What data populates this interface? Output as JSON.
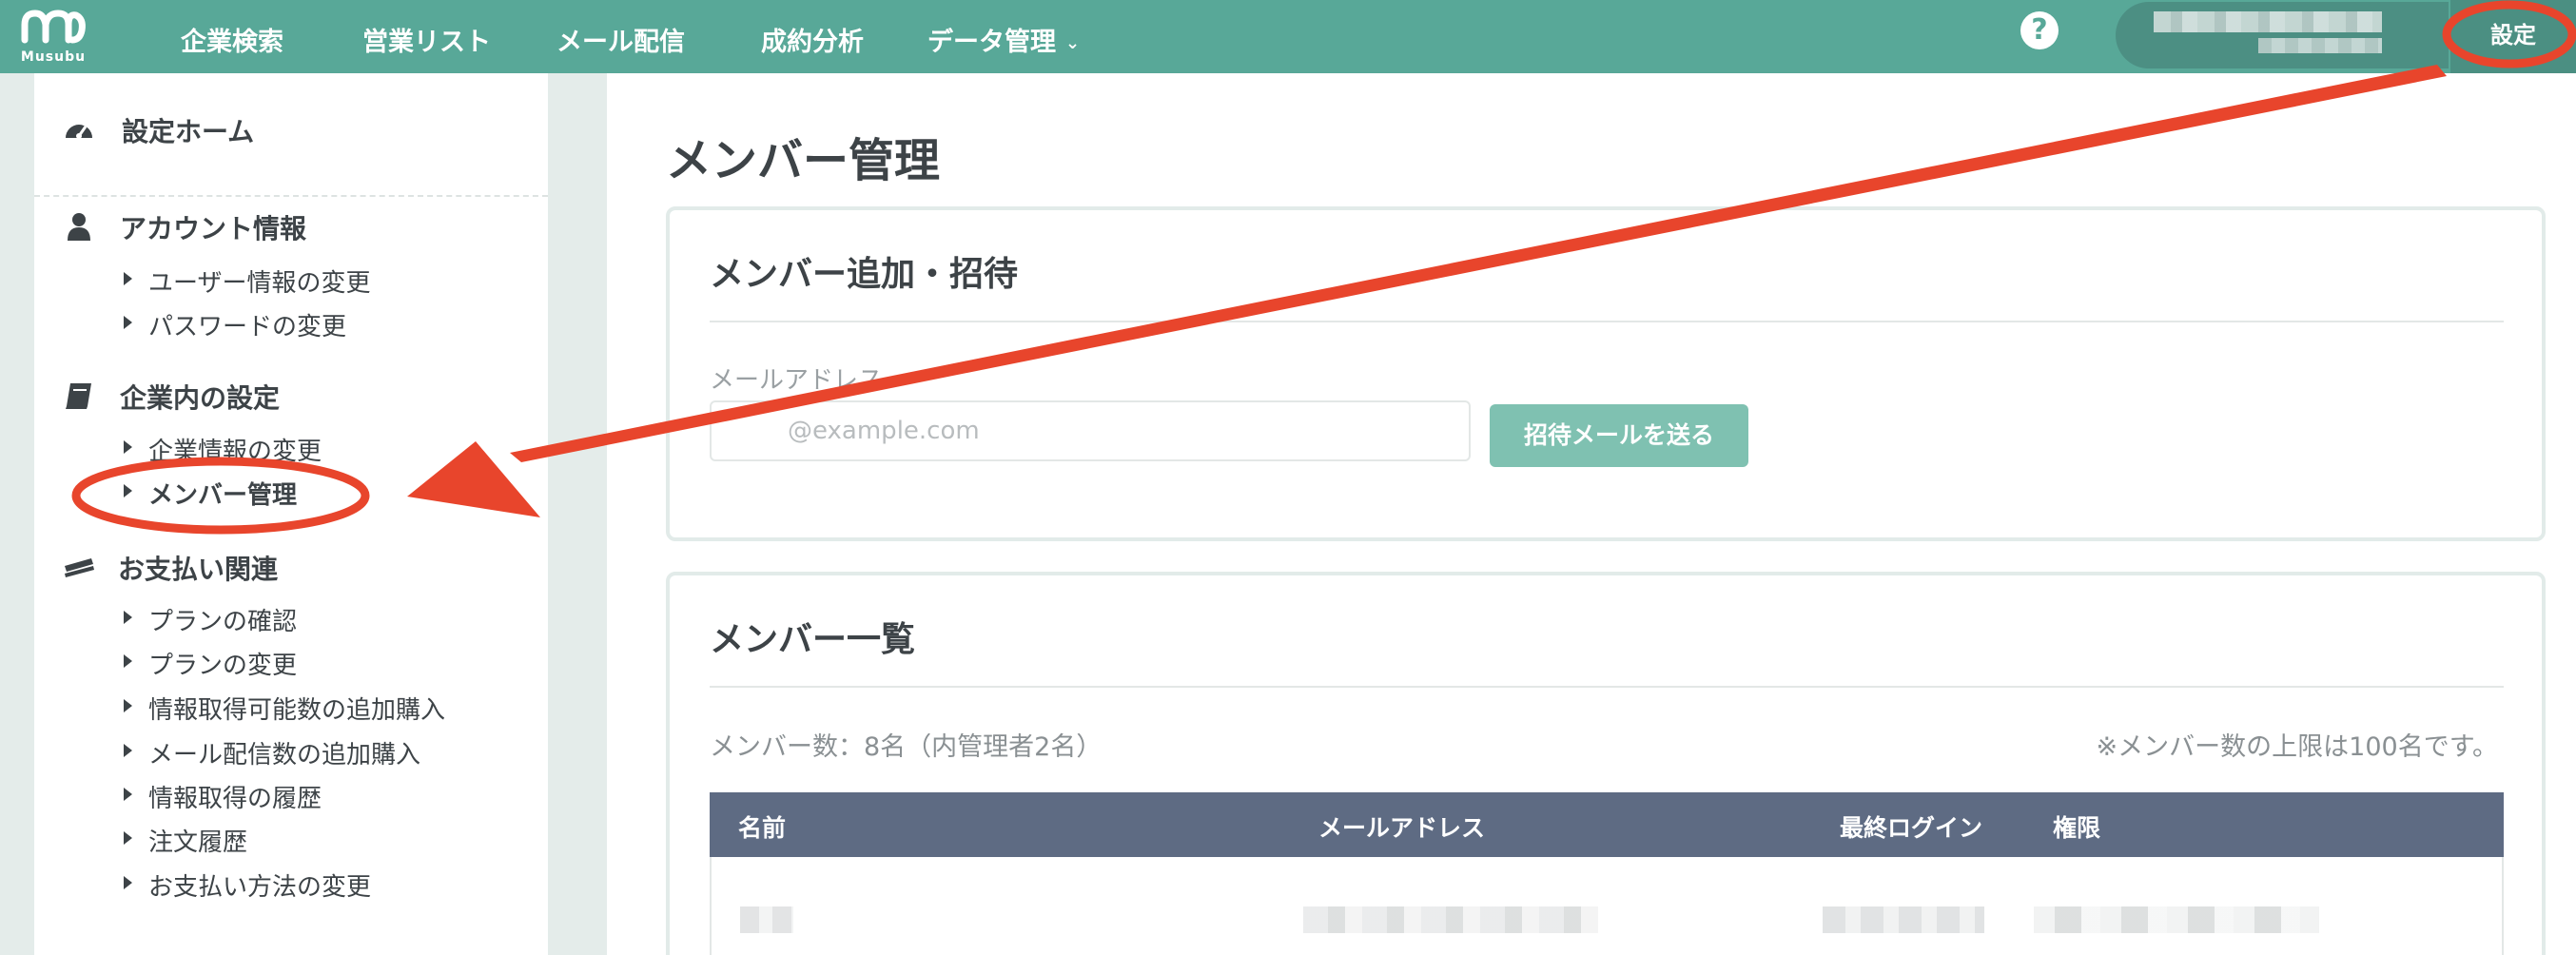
{
  "header": {
    "logo_text": "Musubu",
    "nav": [
      {
        "label": "企業検索"
      },
      {
        "label": "営業リスト"
      },
      {
        "label": "メール配信"
      },
      {
        "label": "成約分析"
      },
      {
        "label": "データ管理"
      }
    ],
    "help_glyph": "?",
    "settings_label": "設定"
  },
  "sidebar": {
    "home": {
      "label": "設定ホーム",
      "icon": "dashboard-icon"
    },
    "sections": [
      {
        "title": "アカウント情報",
        "icon": "user-icon",
        "items": [
          {
            "label": "ユーザー情報の変更"
          },
          {
            "label": "パスワードの変更"
          }
        ]
      },
      {
        "title": "企業内の設定",
        "icon": "book-icon",
        "items": [
          {
            "label": "企業情報の変更"
          },
          {
            "label": "メンバー管理"
          }
        ]
      },
      {
        "title": "お支払い関連",
        "icon": "credit-card-icon",
        "items": [
          {
            "label": "プランの確認"
          },
          {
            "label": "プランの変更"
          },
          {
            "label": "情報取得可能数の追加購入"
          },
          {
            "label": "メール配信数の追加購入"
          },
          {
            "label": "情報取得の履歴"
          },
          {
            "label": "注文履歴"
          },
          {
            "label": "お支払い方法の変更"
          }
        ]
      }
    ]
  },
  "main": {
    "title": "メンバー管理",
    "invite": {
      "title": "メンバー追加・招待",
      "field_label": "メールアドレス",
      "placeholder": "@example.com",
      "button": "招待メールを送る"
    },
    "list": {
      "title": "メンバー一覧",
      "count_text": "メンバー数：8名（内管理者2名）",
      "limit_text": "※メンバー数の上限は100名です。",
      "columns": [
        "名前",
        "メールアドレス",
        "最終ログイン",
        "権限"
      ]
    }
  },
  "colors": {
    "header": "#58a898",
    "accent_button": "#7fc1b1",
    "table_header": "#5e6b83",
    "annotation": "#e8452c"
  }
}
